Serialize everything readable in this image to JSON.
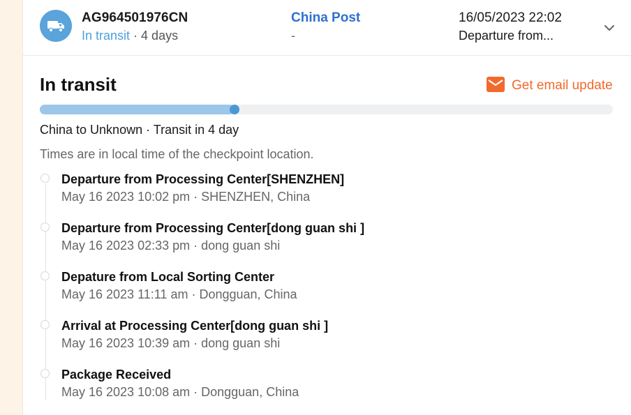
{
  "colors": {
    "accent": "#4e9fdc",
    "carrier": "#2f6fd1",
    "email": "#f26a2c",
    "progress_fill": "#9cc6ea",
    "progress_track": "#eff0f2"
  },
  "summary": {
    "tracking_number": "AG964501976CN",
    "status": "In transit",
    "duration": "· 4 days",
    "carrier": "China Post",
    "carrier_sub": "-",
    "latest_time": "16/05/2023 22:02",
    "latest_event": "Departure from...",
    "icon": "truck-icon",
    "expand_icon": "chevron-down-icon"
  },
  "detail": {
    "title": "In transit",
    "email_label": "Get email update",
    "email_icon": "envelope-icon",
    "progress_fraction": 0.34,
    "route": "China to Unknown · Transit in 4 day",
    "timezone_note": "Times are in local time of the checkpoint location."
  },
  "events": [
    {
      "title": "Departure from Processing Center[SHENZHEN]",
      "meta": "May 16 2023 10:02 pm · SHENZHEN, China"
    },
    {
      "title": "Departure from Processing Center[dong guan shi ]",
      "meta": "May 16 2023 02:33 pm · dong guan shi"
    },
    {
      "title": "Depature from Local Sorting Center",
      "meta": "May 16 2023 11:11 am · Dongguan, China"
    },
    {
      "title": "Arrival at Processing Center[dong guan shi ]",
      "meta": "May 16 2023 10:39 am · dong guan shi"
    },
    {
      "title": "Package Received",
      "meta": "May 16 2023 10:08 am · Dongguan, China"
    }
  ]
}
